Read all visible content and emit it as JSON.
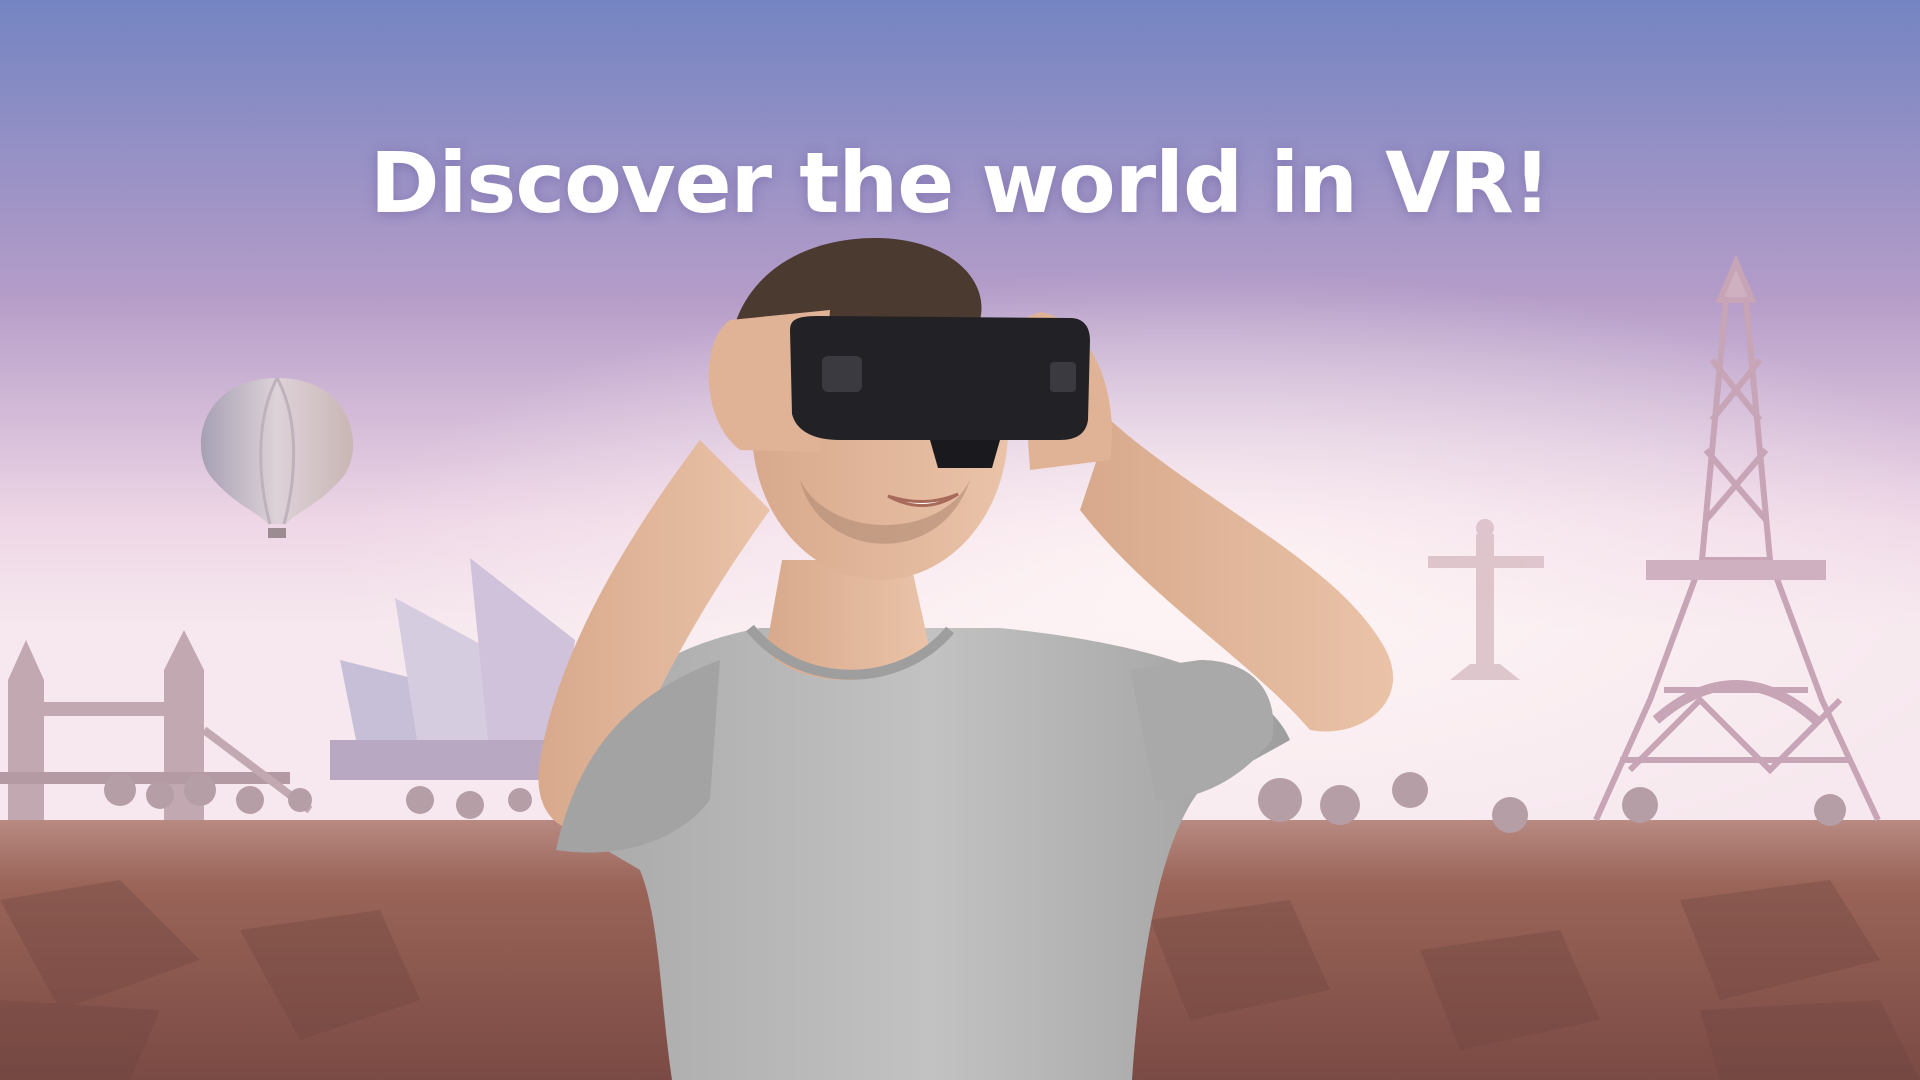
{
  "headline": "Discover the world in VR!",
  "colors": {
    "sky_top": "#7082c0",
    "sky_mid": "#c6a6d0",
    "sky_horizon": "#f2e4ee",
    "ground": "#9a6458",
    "ground_dark": "#6e4440",
    "landmark": "#cdb8c9",
    "shirt": "#b8b8b8",
    "skin": "#e2b79a",
    "hair": "#4a3a30",
    "headset": "#222226"
  },
  "scene_elements": [
    "hot-air-balloon",
    "tower-bridge",
    "sydney-opera-house",
    "christ-the-redeemer",
    "eiffel-tower",
    "low-poly-trees",
    "man-wearing-vr-headset"
  ]
}
